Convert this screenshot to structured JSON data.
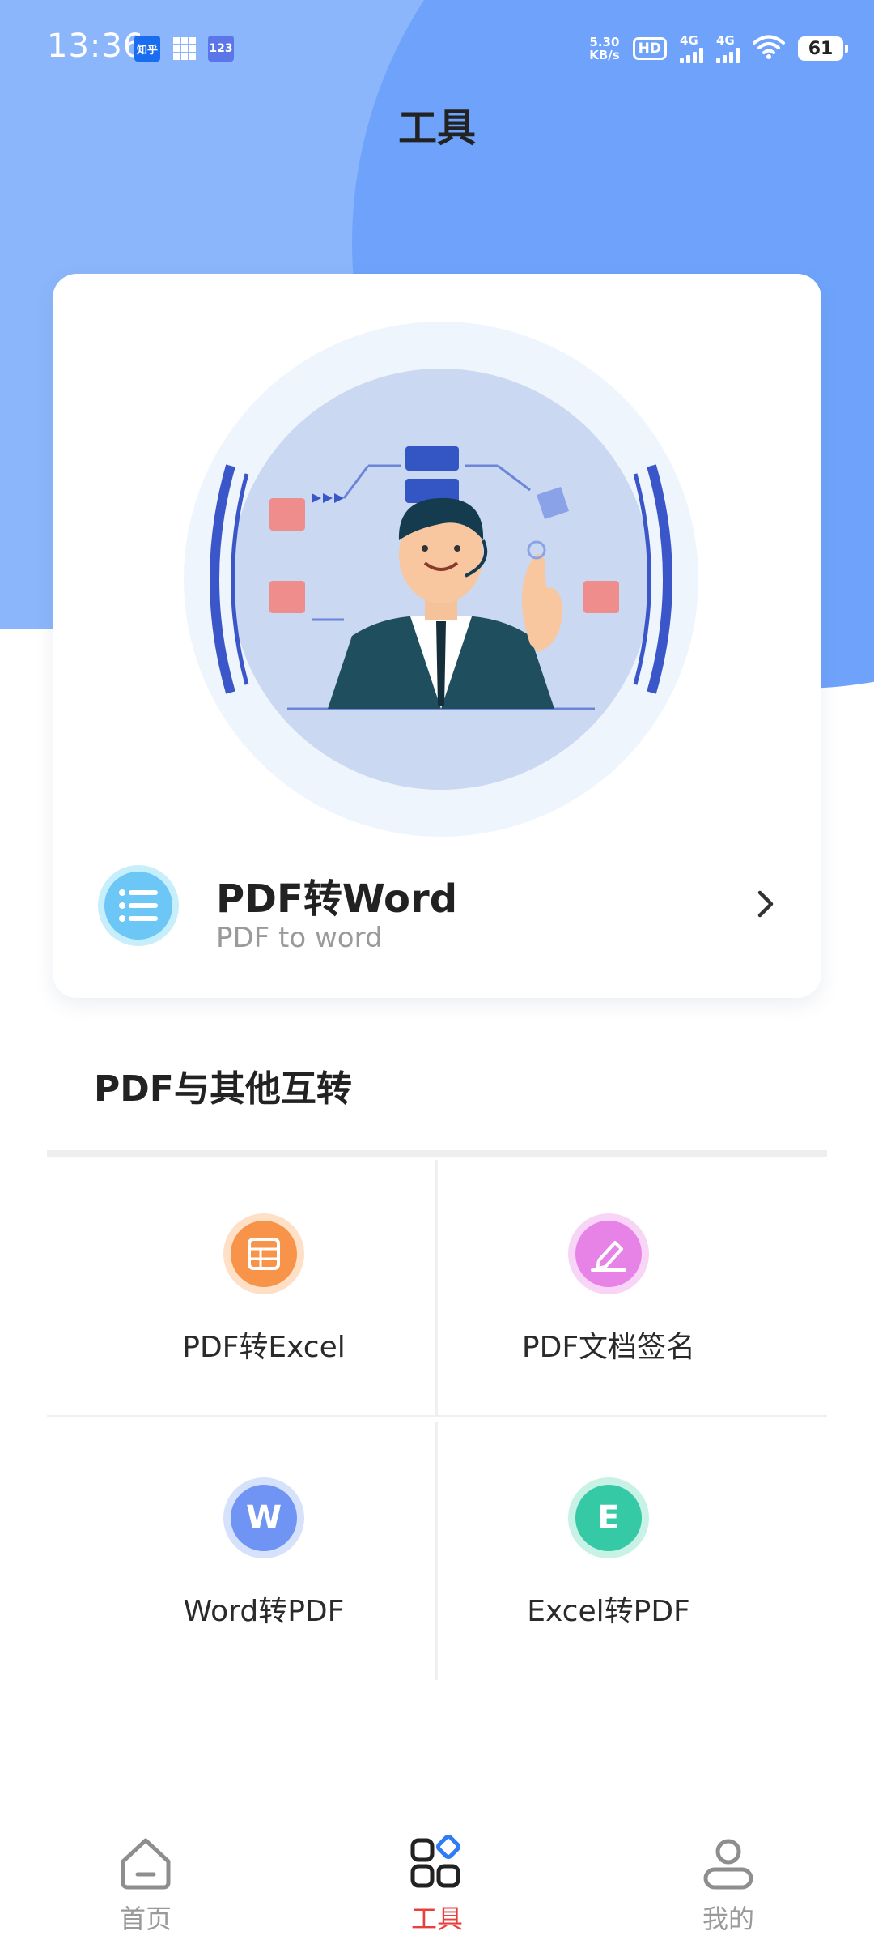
{
  "status_bar": {
    "time": "13:36",
    "app_icons": [
      "zhihu-icon",
      "grid-app-icon",
      "123-app-icon"
    ],
    "zhihu_text": "知乎",
    "app_123_text": "123",
    "net_speed_value": "5.30",
    "net_speed_unit": "KB/s",
    "hd_label": "HD",
    "sim1_label": "4G",
    "sim2_label": "4G",
    "battery_level": "61"
  },
  "header": {
    "title": "工具",
    "colors": {
      "background": "#8cb6fb",
      "arc": "#6fa3fb"
    }
  },
  "feature_card": {
    "title": "PDF转Word",
    "subtitle": "PDF to word",
    "icon": "list-icon",
    "arrow_icon": "chevron-right-icon"
  },
  "section": {
    "title": "PDF与其他互转"
  },
  "tools": [
    {
      "label": "PDF转Excel",
      "icon": "table-icon",
      "color": "#f7944a",
      "ring": "#fde0c6"
    },
    {
      "label": "PDF文档签名",
      "icon": "pen-sign-icon",
      "color": "#e782e6",
      "ring": "#f8d4f7"
    },
    {
      "label": "Word转PDF",
      "icon": "word-w-icon",
      "glyph": "W",
      "color": "#6f94f4",
      "ring": "#d6e2fc"
    },
    {
      "label": "Excel转PDF",
      "icon": "excel-e-icon",
      "glyph": "E",
      "color": "#36c9a6",
      "ring": "#c9f2e6"
    }
  ],
  "bottom_nav": {
    "items": [
      {
        "label": "首页",
        "icon": "home-icon",
        "active": false
      },
      {
        "label": "工具",
        "icon": "tools-grid-icon",
        "active": true
      },
      {
        "label": "我的",
        "icon": "profile-icon",
        "active": false
      }
    ],
    "active_color": "#e8413d",
    "inactive_color": "#9a9a9a"
  }
}
